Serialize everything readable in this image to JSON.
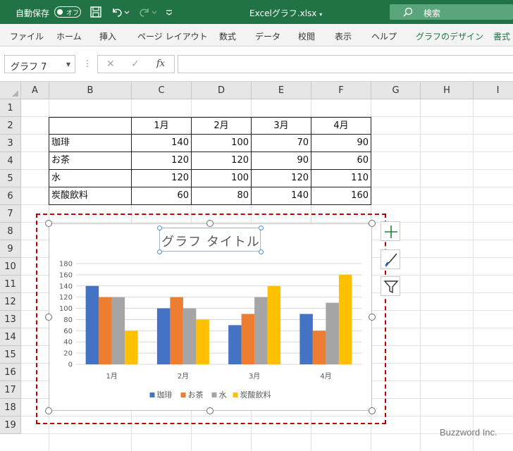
{
  "titlebar": {
    "autosave_label": "自動保存",
    "autosave_state": "オフ",
    "filename": "Excelグラフ.xlsx",
    "search_label": "検索"
  },
  "ribbon": {
    "tabs": [
      "ファイル",
      "ホーム",
      "挿入",
      "ページ レイアウト",
      "数式",
      "データ",
      "校閲",
      "表示",
      "ヘルプ",
      "グラフのデザイン",
      "書式"
    ]
  },
  "formula_bar": {
    "name_box": "グラフ 7",
    "fx_label": "fx",
    "cancel_glyph": "✕",
    "enter_glyph": "✓",
    "formula": ""
  },
  "sheet": {
    "columns": [
      "A",
      "B",
      "C",
      "D",
      "E",
      "F",
      "G",
      "H",
      "I"
    ],
    "rows": [
      "1",
      "2",
      "3",
      "4",
      "5",
      "6",
      "7",
      "8",
      "9",
      "10",
      "11",
      "12",
      "13",
      "14",
      "15",
      "16",
      "17",
      "18",
      "19"
    ],
    "table": {
      "headers": [
        "",
        "1月",
        "2月",
        "3月",
        "4月"
      ],
      "rows": [
        [
          "珈琲",
          "140",
          "100",
          "70",
          "90"
        ],
        [
          "お茶",
          "120",
          "120",
          "90",
          "60"
        ],
        [
          "水",
          "120",
          "100",
          "120",
          "110"
        ],
        [
          "炭酸飲料",
          "60",
          "80",
          "140",
          "160"
        ]
      ]
    }
  },
  "chart_data": {
    "type": "bar",
    "title": "グラフ タイトル",
    "categories": [
      "1月",
      "2月",
      "3月",
      "4月"
    ],
    "series": [
      {
        "name": "珈琲",
        "values": [
          140,
          100,
          70,
          90
        ],
        "color": "#4472c4"
      },
      {
        "name": "お茶",
        "values": [
          120,
          120,
          90,
          60
        ],
        "color": "#ed7d31"
      },
      {
        "name": "水",
        "values": [
          120,
          100,
          120,
          110
        ],
        "color": "#a5a5a5"
      },
      {
        "name": "炭酸飲料",
        "values": [
          60,
          80,
          140,
          160
        ],
        "color": "#ffc000"
      }
    ],
    "ylim": [
      0,
      180
    ],
    "yticks": [
      0,
      20,
      40,
      60,
      80,
      100,
      120,
      140,
      160,
      180
    ],
    "grid": true,
    "legend": "bottom"
  },
  "side_buttons": [
    "chart-elements-icon",
    "chart-styles-icon",
    "chart-filters-icon"
  ],
  "watermark": "Buzzword Inc.",
  "colors": {
    "excel_green": "#217346",
    "selection": "#c00000"
  }
}
